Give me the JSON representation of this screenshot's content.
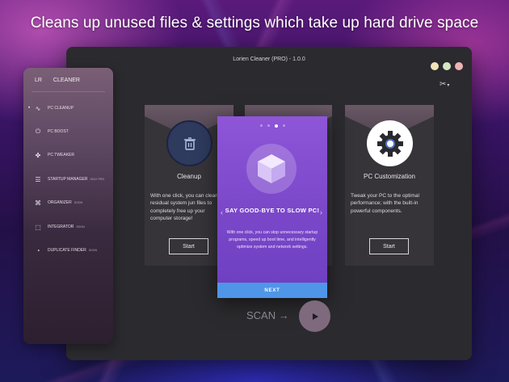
{
  "headline": "Cleans up unused files & settings which take up hard drive space",
  "window": {
    "title": "Lorien Cleaner (PRO) - 1.0.0",
    "tools_icon": "tools-icon"
  },
  "sidebar": {
    "logo": "LR",
    "brand": "CLEANER",
    "items": [
      {
        "label": "PC CLEANUP",
        "icon": "pulse-icon",
        "tag": "",
        "active": true
      },
      {
        "label": "PC BOOST",
        "icon": "power-icon",
        "tag": ""
      },
      {
        "label": "PC TWEAKER",
        "icon": "puzzle-icon",
        "tag": ""
      },
      {
        "label": "STARTUP MANAGER",
        "icon": "list-icon",
        "tag": "ONLY PRO"
      },
      {
        "label": "ORGANIZER",
        "icon": "network-icon",
        "tag": "SOON"
      },
      {
        "label": "INTEGRATOR",
        "icon": "box-icon",
        "tag": "SOON"
      },
      {
        "label": "DUPLICATE FINDER",
        "icon": "pie-icon",
        "tag": "SOON"
      }
    ]
  },
  "cards": [
    {
      "title": "Cleanup",
      "icon": "trash-icon",
      "description": "With one click, you can clean residual system jun files to completely free up your computer storage!",
      "button": "Start"
    },
    {
      "title": "PC Customization",
      "icon": "gear-icon",
      "description": "Tweak your PC to the optimal performance; with the built-in powerful components.",
      "button": "Start"
    }
  ],
  "modal": {
    "page_count": 4,
    "active_page": 3,
    "icon": "cube-icon",
    "title": "SAY GOOD-BYE TO SLOW PC!",
    "description": "With one click, you can stop unnecessary startup programs, speed up boot time, and intelligently optimize system and network settings.",
    "next_label": "NEXT"
  },
  "scan": {
    "label": "SCAN →",
    "icon": "play-icon"
  },
  "colors": {
    "modal_accent": "#7a47c9",
    "next_button": "#4f96e8",
    "window_bg": "#2b2a2e"
  }
}
